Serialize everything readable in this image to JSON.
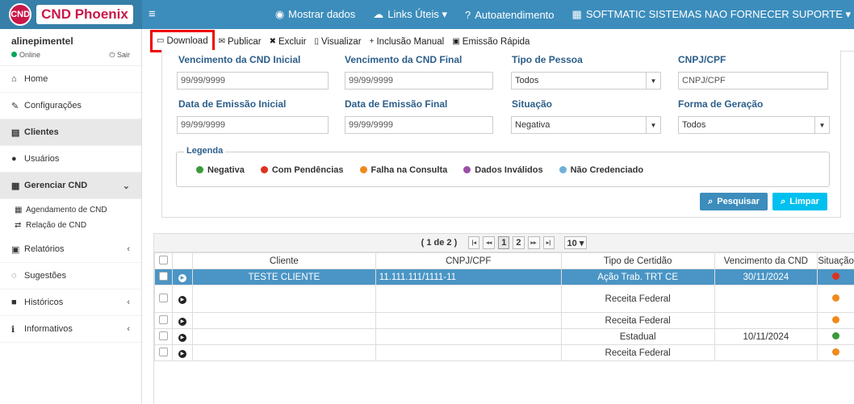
{
  "header": {
    "logo_badge": "CND",
    "logo_text": "CND Phoenix",
    "toggle": "≡",
    "nav": [
      {
        "icon": "eye-icon",
        "glyph": "◉",
        "label": "Mostrar dados"
      },
      {
        "icon": "cloud-icon",
        "glyph": "☁",
        "label": "Links Úteis ▾"
      },
      {
        "icon": "question-icon",
        "glyph": "?",
        "label": "Autoatendimento"
      },
      {
        "icon": "building-icon",
        "glyph": "▦",
        "label": "SOFTMATIC SISTEMAS NAO FORNECER SUPORTE ▾"
      }
    ]
  },
  "sidebar": {
    "user": "alinepimentel",
    "status": "Online",
    "logout": "Sair",
    "items": [
      {
        "icon": "home-icon",
        "glyph": "⌂",
        "label": "Home"
      },
      {
        "icon": "wrench-icon",
        "glyph": "✎",
        "label": "Configurações"
      },
      {
        "icon": "clients-icon",
        "glyph": "▤",
        "label": "Clientes"
      },
      {
        "icon": "user-icon",
        "glyph": "●",
        "label": "Usuários"
      },
      {
        "icon": "calendar-icon",
        "glyph": "▦",
        "label": "Gerenciar CND",
        "chev": "⌄"
      },
      {
        "icon": "report-icon",
        "glyph": "▣",
        "label": "Relatórios",
        "chev": "‹"
      },
      {
        "icon": "comment-icon",
        "glyph": "◌",
        "label": "Sugestões"
      },
      {
        "icon": "history-icon",
        "glyph": "■",
        "label": "Históricos",
        "chev": "‹"
      },
      {
        "icon": "info-icon",
        "glyph": "ℹ",
        "label": "Informativos",
        "chev": "‹"
      }
    ],
    "subitems": [
      {
        "icon": "calendar-small-icon",
        "glyph": "▦",
        "label": "Agendamento de CND"
      },
      {
        "icon": "exchange-icon",
        "glyph": "⇄",
        "label": "Relação de CND"
      }
    ]
  },
  "toolbar": {
    "items": [
      {
        "icon": "folder-icon",
        "glyph": "▭",
        "label": "Download"
      },
      {
        "icon": "envelope-icon",
        "glyph": "✉",
        "label": "Publicar"
      },
      {
        "icon": "trash-icon",
        "glyph": "✖",
        "label": "Excluir"
      },
      {
        "icon": "file-icon",
        "glyph": "▯",
        "label": "Visualizar"
      },
      {
        "icon": "plus-icon",
        "glyph": "+",
        "label": "Inclusão Manual"
      },
      {
        "icon": "edit-icon",
        "glyph": "▣",
        "label": "Emissão Rápida"
      }
    ]
  },
  "filters": {
    "venc_inicial_label": "Vencimento da CND Inicial",
    "venc_inicial_value": "99/99/9999",
    "venc_final_label": "Vencimento da CND Final",
    "venc_final_value": "99/99/9999",
    "tipo_pessoa_label": "Tipo de Pessoa",
    "tipo_pessoa_value": "Todos",
    "cnpj_label": "CNPJ/CPF",
    "cnpj_placeholder": "CNPJ/CPF",
    "emissao_inicial_label": "Data de Emissão Inicial",
    "emissao_inicial_value": "99/99/9999",
    "emissao_final_label": "Data de Emissão Final",
    "emissao_final_value": "99/99/9999",
    "situacao_label": "Situação",
    "situacao_value": "Negativa",
    "geracao_label": "Forma de Geração",
    "geracao_value": "Todos"
  },
  "legend": {
    "title": "Legenda",
    "items": [
      {
        "label": "Negativa",
        "color": "#3a9a3a"
      },
      {
        "label": "Com Pendências",
        "color": "#e0301e"
      },
      {
        "label": "Falha na Consulta",
        "color": "#f08a1c"
      },
      {
        "label": "Dados Inválidos",
        "color": "#9b4ea8"
      },
      {
        "label": "Não Credenciado",
        "color": "#6fb0d8"
      }
    ]
  },
  "buttons": {
    "pesquisar": "Pesquisar",
    "limpar": "Limpar"
  },
  "pager": {
    "summary": "( 1 de 2 )",
    "pages": [
      "1",
      "2"
    ],
    "per_page": "10 ▾",
    "first": "|◂",
    "prev": "◂◂",
    "next": "▸▸",
    "last": "▸|"
  },
  "table": {
    "headers": [
      "Cliente",
      "CNPJ/CPF",
      "Tipo de Certidão",
      "Vencimento da CND",
      "Situação"
    ],
    "rows": [
      {
        "cliente": "TESTE CLIENTE",
        "cnpj": "11.111.111/1111-11",
        "tipo": "Ação Trab. TRT CE",
        "venc": "30/11/2024",
        "color": "#e0301e",
        "selected": true
      },
      {
        "cliente": "",
        "cnpj": "",
        "tipo": "Receita Federal",
        "venc": "",
        "color": "#f08a1c",
        "selected": false
      },
      {
        "cliente": "",
        "cnpj": "",
        "tipo": "Receita Federal",
        "venc": "",
        "color": "#f08a1c",
        "selected": false
      },
      {
        "cliente": "",
        "cnpj": "",
        "tipo": "Estadual",
        "venc": "10/11/2024",
        "color": "#3a9a3a",
        "selected": false
      },
      {
        "cliente": "",
        "cnpj": "",
        "tipo": "Receita Federal",
        "venc": "",
        "color": "#f08a1c",
        "selected": false
      }
    ]
  }
}
